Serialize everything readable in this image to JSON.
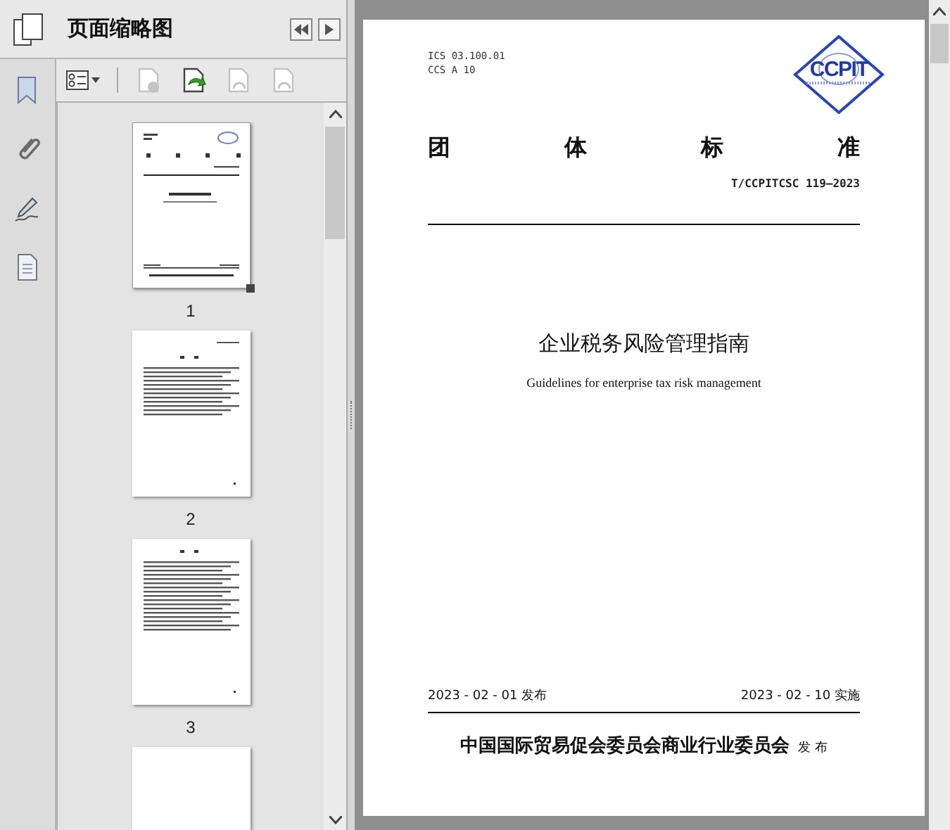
{
  "panel": {
    "title": "页面缩略图"
  },
  "toolbar": [
    {
      "kind": "options",
      "disabled": false
    },
    {
      "kind": "delete",
      "disabled": true
    },
    {
      "kind": "insert",
      "disabled": false
    },
    {
      "kind": "rotate-left",
      "disabled": true
    },
    {
      "kind": "rotate-right",
      "disabled": true
    }
  ],
  "sidebar": {
    "items": [
      {
        "kind": "bookmark",
        "selected": false
      },
      {
        "kind": "attachment",
        "selected": false
      },
      {
        "kind": "signature",
        "selected": false
      },
      {
        "kind": "layers",
        "selected": false
      }
    ]
  },
  "thumbnails": [
    {
      "label": "1",
      "selected": true,
      "kind": "cover"
    },
    {
      "label": "2",
      "selected": false,
      "kind": "toc"
    },
    {
      "label": "3",
      "selected": false,
      "kind": "text"
    }
  ],
  "partial_thumbnail": true,
  "document": {
    "ics": "ICS 03.100.01",
    "ccs": "CCS A 10",
    "logo_text": "CCPIT",
    "heading": [
      "团",
      "体",
      "标",
      "准"
    ],
    "number": "T/CCPITCSC 119—2023",
    "title": "企业税务风险管理指南",
    "title_en": "Guidelines for enterprise tax risk management",
    "issued": "2023 - 02 - 01 发布",
    "effective": "2023 - 02 - 10 实施",
    "publisher": "中国国际贸易促会委员会商业行业委员会",
    "publisher_suffix": "发 布"
  }
}
